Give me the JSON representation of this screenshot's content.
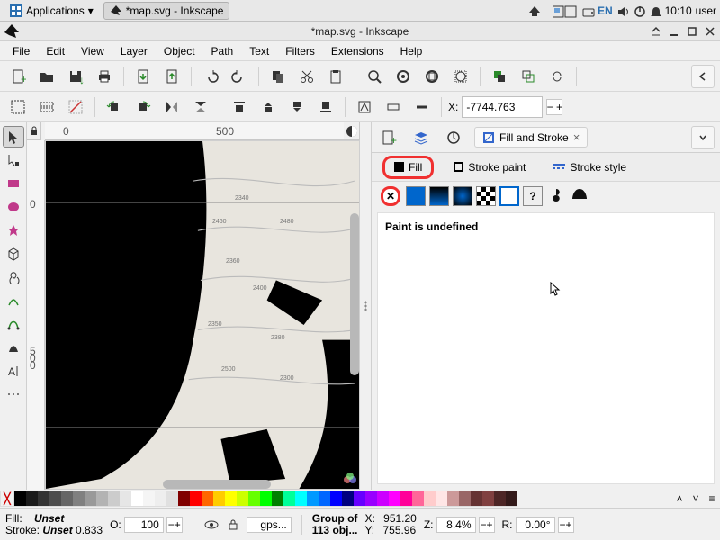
{
  "taskbar": {
    "apps_label": "Applications",
    "window_label": "*map.svg - Inkscape",
    "lang": "EN",
    "clock": "10:10",
    "user": "user"
  },
  "titlebar": {
    "title": "*map.svg - Inkscape"
  },
  "menu": {
    "file": "File",
    "edit": "Edit",
    "view": "View",
    "layer": "Layer",
    "object": "Object",
    "path": "Path",
    "text": "Text",
    "filters": "Filters",
    "extensions": "Extensions",
    "help": "Help"
  },
  "toolbar2": {
    "x_label": "X:",
    "x_value": "-7744.763"
  },
  "ruler": {
    "h0": "0",
    "h500": "500",
    "v0": "0",
    "v5_00": "5\n0\n0"
  },
  "panel": {
    "tab_label": "Fill and Stroke",
    "subtabs": {
      "fill": "Fill",
      "stroke_paint": "Stroke paint",
      "stroke_style": "Stroke style"
    },
    "questionmark": "?",
    "message": "Paint is undefined"
  },
  "palette": {
    "grays": [
      "#000000",
      "#1a1a1a",
      "#333333",
      "#4d4d4d",
      "#666666",
      "#808080",
      "#999999",
      "#b3b3b3",
      "#cccccc",
      "#e6e6e6",
      "#ffffff",
      "#f5f5f5",
      "#eeeeee",
      "#e0e0e0"
    ],
    "colors": [
      "#800000",
      "#ff0000",
      "#ff6600",
      "#ffcc00",
      "#ffff00",
      "#ccff00",
      "#66ff00",
      "#00ff00",
      "#008000",
      "#00ff99",
      "#00ffff",
      "#0099ff",
      "#0066ff",
      "#0000ff",
      "#000080",
      "#6600ff",
      "#9900ff",
      "#cc00ff",
      "#ff00ff",
      "#ff0099",
      "#ff6699",
      "#ffcccc",
      "#ffe6e6",
      "#cc9999",
      "#996666",
      "#663333",
      "#804040",
      "#4d2626",
      "#331a1a"
    ]
  },
  "status": {
    "fill_label": "Fill:",
    "fill_value": "Unset",
    "stroke_label": "Stroke:",
    "stroke_value": "Unset",
    "opacity_label": "O:",
    "opacity_value": "100",
    "layer_name": "gps...",
    "selection_l1": "Group of",
    "selection_l2": "113 obj...",
    "x_label": "X:",
    "x_value": "951.20",
    "y_label": "Y:",
    "y_value": "755.96",
    "z_label": "Z:",
    "z_value": "8.4%",
    "r_label": "R:",
    "r_value": "0.00°"
  },
  "contours": [
    "2340",
    "2460",
    "2480",
    "2360",
    "2400",
    "2350",
    "2380",
    "2500",
    "2300"
  ]
}
